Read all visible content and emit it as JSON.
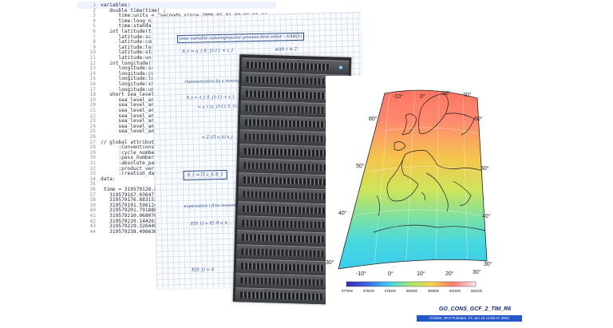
{
  "code_panel": {
    "lines": [
      {
        "n": "1",
        "t": "variables:"
      },
      {
        "n": "2",
        "t": "   double time(time) ;"
      },
      {
        "n": "3",
        "t": "      time:units = \"seconds since 2000-01-01 00:00:00.0\" ;"
      },
      {
        "n": "4",
        "t": "      time:long_name = \"time (sec. since 2000-01-01)\" ;"
      },
      {
        "n": "5",
        "t": "      time:standard_name = \"time\" ;"
      },
      {
        "n": "6",
        "t": "   int latitude(time) ;"
      },
      {
        "n": "7",
        "t": "      latitude:scale_facto"
      },
      {
        "n": "8",
        "t": "      latitude:comments ="
      },
      {
        "n": "9",
        "t": "      latitude:long_name ="
      },
      {
        "n": "10",
        "t": "      latitude:standard_na"
      },
      {
        "n": "11",
        "t": "      latitude:units = \"de"
      },
      {
        "n": "12",
        "t": "   int longitude(time) ;"
      },
      {
        "n": "13",
        "t": "      longitude:scale_fact"
      },
      {
        "n": "14",
        "t": "      longitude:comments ="
      },
      {
        "n": "15",
        "t": "      longitude:long_name"
      },
      {
        "n": "16",
        "t": "      longitude:standard_n"
      },
      {
        "n": "17",
        "t": "      longitude:units = \"d"
      },
      {
        "n": "18",
        "t": "   short sea_level_anomal"
      },
      {
        "n": "19",
        "t": "      sea_level_anomaly:_F"
      },
      {
        "n": "20",
        "t": "      sea_level_anomaly:qu"
      },
      {
        "n": "21",
        "t": "      sea_level_anomaly:sc"
      },
      {
        "n": "22",
        "t": "      sea_level_anomaly:co"
      },
      {
        "n": "23",
        "t": "      sea_level_anomaly:lo"
      },
      {
        "n": "24",
        "t": "      sea_level_anomaly:st"
      },
      {
        "n": "25",
        "t": "      sea_level_anomaly:un"
      },
      {
        "n": "26",
        "t": ""
      },
      {
        "n": "27",
        "t": "// global attributes:"
      },
      {
        "n": "28",
        "t": "      :Conventions = \"CF-1"
      },
      {
        "n": "29",
        "t": "      :cycle_number = 299L"
      },
      {
        "n": "30",
        "t": "      :pass_number = 96LL"
      },
      {
        "n": "31",
        "t": "      :absolute_pass_numbe"
      },
      {
        "n": "32",
        "t": "      :product_version = \""
      },
      {
        "n": "33",
        "t": "      :creation_date = \"20"
      },
      {
        "n": "34",
        "t": "data:"
      },
      {
        "n": "35",
        "t": ""
      },
      {
        "n": "36",
        "t": " time = 319579128.875672,"
      },
      {
        "n": "37",
        "t": "   319579167.03647, 319579"
      },
      {
        "n": "38",
        "t": "   319579176.883152, 319579"
      },
      {
        "n": "39",
        "t": "   319579191.596124, 319579"
      },
      {
        "n": "40",
        "t": "   319579201.791888, 319579"
      },
      {
        "n": "41",
        "t": "   319579210.968076, 319579"
      },
      {
        "n": "42",
        "t": "   319579220.144263, 319579"
      },
      {
        "n": "43",
        "t": "   319579229.320449, 319579"
      },
      {
        "n": "44",
        "t": "   319579238.496636, 319579"
      }
    ]
  },
  "notes": {
    "heading": "time variable autoregressive process first order – VAR(1)",
    "eq1": "S_t = a_t S_{t-1} + ε_t",
    "eq1_note": "with t ≥ 2",
    "representation": "representation by a moving average",
    "eq2": "S_t = a_t S_{t-1} + ε_t",
    "eq3": "= a_t (a_{t-1} S_{t-2} + ε_{t-1}) + ε_t",
    "eq4": "= Σ (Π a_k) ε_j",
    "eq5": "S_t = Π a_k S_1",
    "expectation": "expectation ( first moment )",
    "eq6": "E[S_t] = E[ Π a_k ...",
    "eq7": "E[S_t] = 0"
  },
  "map": {
    "lat_labels_left": [
      "60°",
      "50°",
      "40°",
      "30°"
    ],
    "lat_labels_right": [
      "60°",
      "50°",
      "40°",
      "30°"
    ],
    "lon_labels_top": [
      "-10°",
      "0°",
      "10°",
      "20°"
    ],
    "lon_labels_bottom": [
      "-10°",
      "0°",
      "10°",
      "20°",
      "30°"
    ],
    "colorbar_ticks": [
      "977600",
      "978400",
      "979200",
      "980000",
      "980800",
      "981600",
      "982400"
    ]
  },
  "colors": {
    "notes_ink": "#274a86",
    "footer_stamp": "#2457c7",
    "title": "#1a2a78"
  },
  "figure_title": "GO_CONS_GCF_2_TIM_R6",
  "footer_text": "ICGEM, GFZ Potsdam, Fri Jun 10 14:06:47 2022"
}
